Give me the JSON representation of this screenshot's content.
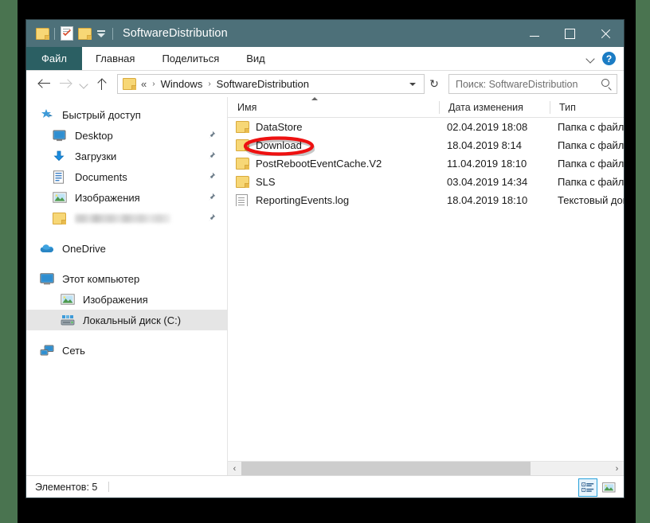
{
  "window": {
    "title": "SoftwareDistribution",
    "quick_access": [
      "folder-icon",
      "properties-icon",
      "new-folder-icon",
      "customize-dropdown-icon"
    ],
    "controls": {
      "minimize": "minimize-icon",
      "maximize": "maximize-icon",
      "close": "close-icon"
    }
  },
  "ribbon": {
    "tabs": [
      {
        "label": "Файл",
        "active": true
      },
      {
        "label": "Главная",
        "active": false
      },
      {
        "label": "Поделиться",
        "active": false
      },
      {
        "label": "Вид",
        "active": false
      }
    ],
    "expand_icon": "chevron-down-icon",
    "help_icon": "?",
    "accent_teal": "#2b5f63"
  },
  "address": {
    "back": "←",
    "forward": "→",
    "recent": "⌄",
    "up": "↑",
    "crumbs": [
      "«",
      "Windows",
      "SoftwareDistribution"
    ],
    "separator": "›",
    "refresh": "↻"
  },
  "search": {
    "placeholder": "Поиск: SoftwareDistribution",
    "value": "",
    "icon": "search-icon"
  },
  "sidebar": {
    "groups": [
      {
        "header": {
          "label": "Быстрый доступ",
          "icon": "star-pin-icon"
        },
        "items": [
          {
            "label": "Desktop",
            "icon": "desktop-icon",
            "pinned": true,
            "blurred": false
          },
          {
            "label": "Загрузки",
            "icon": "downloads-icon",
            "pinned": true,
            "blurred": false
          },
          {
            "label": "Documents",
            "icon": "documents-icon",
            "pinned": true,
            "blurred": false
          },
          {
            "label": "Изображения",
            "icon": "pictures-icon",
            "pinned": true,
            "blurred": false
          },
          {
            "label": "",
            "icon": "folder-icon",
            "pinned": true,
            "blurred": true
          }
        ]
      },
      {
        "header": {
          "label": "OneDrive",
          "icon": "onedrive-cloud-icon"
        },
        "items": []
      },
      {
        "header": {
          "label": "Этот компьютер",
          "icon": "this-pc-icon"
        },
        "items": [
          {
            "label": "Изображения",
            "icon": "pictures-icon",
            "pinned": false,
            "blurred": false,
            "selected": false
          },
          {
            "label": "Локальный диск (C:)",
            "icon": "hard-drive-icon",
            "pinned": false,
            "blurred": false,
            "selected": true
          }
        ]
      },
      {
        "header": {
          "label": "Сеть",
          "icon": "network-icon"
        },
        "items": []
      }
    ]
  },
  "filelist": {
    "columns": [
      {
        "label": "Имя",
        "sorted": "asc"
      },
      {
        "label": "Дата изменения",
        "sorted": ""
      },
      {
        "label": "Тип",
        "sorted": ""
      }
    ],
    "rows": [
      {
        "name": "DataStore",
        "icon": "folder-icon",
        "date": "02.04.2019 18:08",
        "type": "Папка с файлами",
        "highlighted": false
      },
      {
        "name": "Download",
        "icon": "folder-icon",
        "date": "18.04.2019 8:14",
        "type": "Папка с файлами",
        "highlighted": true
      },
      {
        "name": "PostRebootEventCache.V2",
        "icon": "folder-icon",
        "date": "11.04.2019 18:10",
        "type": "Папка с файлами",
        "highlighted": false
      },
      {
        "name": "SLS",
        "icon": "folder-icon",
        "date": "03.04.2019 14:34",
        "type": "Папка с файлами",
        "highlighted": false
      },
      {
        "name": "ReportingEvents.log",
        "icon": "text-document-icon",
        "date": "18.04.2019 18:10",
        "type": "Текстовый докум.",
        "highlighted": false
      }
    ]
  },
  "scrollbar": {
    "left_arrow": "‹",
    "right_arrow": "›",
    "thumb_pct": 78
  },
  "status": {
    "item_count_label": "Элементов: 5",
    "views": [
      {
        "name": "details-view-button",
        "active": true
      },
      {
        "name": "large-icons-view-button",
        "active": false
      }
    ]
  },
  "annotation": {
    "shape": "ellipse",
    "color": "#ee1111",
    "target": "Download"
  }
}
